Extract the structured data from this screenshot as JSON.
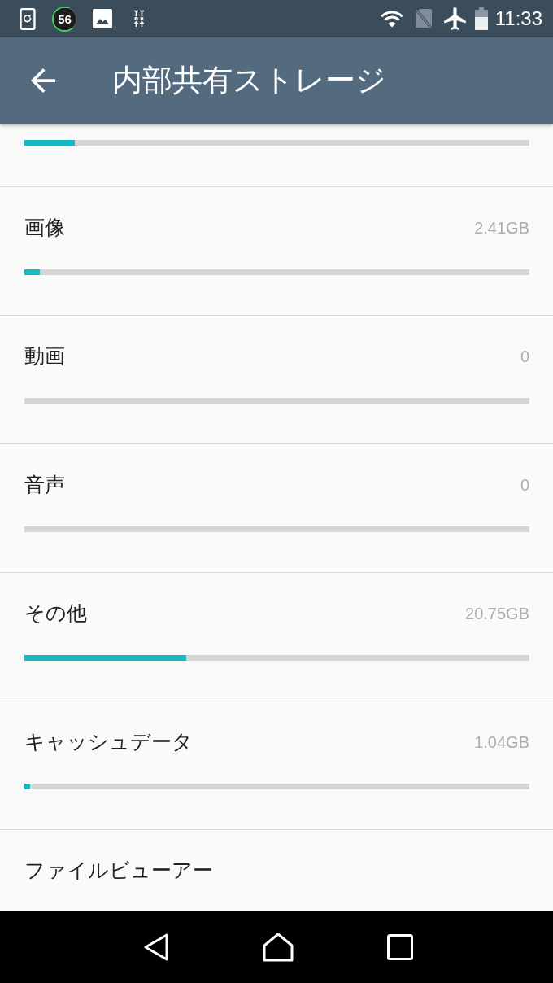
{
  "status_bar": {
    "notification_count": "56",
    "time": "11:33"
  },
  "app_bar": {
    "title": "内部共有ストレージ"
  },
  "storage_items": [
    {
      "kind": "bar",
      "level": 0.1
    },
    {
      "kind": "category",
      "label": "画像",
      "size": "2.41GB",
      "level": 0.03
    },
    {
      "kind": "category",
      "label": "動画",
      "size": "0"
    },
    {
      "kind": "category",
      "label": "音声",
      "size": "0"
    },
    {
      "kind": "category",
      "label": "その他",
      "size": "20.75GB",
      "level": 0.32
    },
    {
      "kind": "category",
      "label": "キャッシュデータ",
      "size": "1.04GB",
      "level": 0.011
    },
    {
      "kind": "link",
      "label": "ファイルビューアー"
    }
  ]
}
